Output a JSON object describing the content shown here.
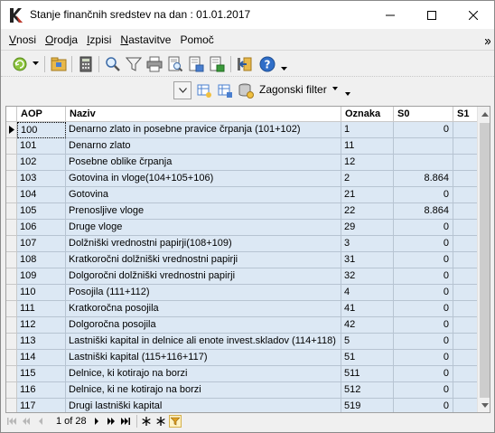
{
  "window": {
    "title": "Stanje finančnih sredstev na dan : 01.01.2017"
  },
  "menu": {
    "vnosi": {
      "accel": "V",
      "rest": "nosi"
    },
    "orodja": {
      "accel": "O",
      "rest": "rodja"
    },
    "izpisi": {
      "accel": "I",
      "rest": "zpisi"
    },
    "nastavitve": {
      "accel": "N",
      "rest": "astavitve"
    },
    "pomoc": {
      "accel": "",
      "rest": "Pomoč"
    }
  },
  "toolbar2": {
    "filter_label": "Zagonski filter"
  },
  "grid": {
    "headers": {
      "aop": "AOP",
      "naziv": "Naziv",
      "oznaka": "Oznaka",
      "s0": "S0",
      "s1": "S1"
    },
    "rows": [
      {
        "aop": "100",
        "naziv": "Denarno zlato in posebne pravice črpanja (101+102)",
        "oznaka": "1",
        "s0": "0"
      },
      {
        "aop": "101",
        "naziv": "Denarno zlato",
        "oznaka": "11",
        "s0": ""
      },
      {
        "aop": "102",
        "naziv": "Posebne oblike črpanja",
        "oznaka": "12",
        "s0": ""
      },
      {
        "aop": "103",
        "naziv": "Gotovina in vloge(104+105+106)",
        "oznaka": "2",
        "s0": "8.864"
      },
      {
        "aop": "104",
        "naziv": "Gotovina",
        "oznaka": "21",
        "s0": "0"
      },
      {
        "aop": "105",
        "naziv": "Prenosljive vloge",
        "oznaka": "22",
        "s0": "8.864"
      },
      {
        "aop": "106",
        "naziv": "Druge vloge",
        "oznaka": "29",
        "s0": "0"
      },
      {
        "aop": "107",
        "naziv": "Dolžniški vrednostni papirji(108+109)",
        "oznaka": "3",
        "s0": "0"
      },
      {
        "aop": "108",
        "naziv": "Kratkoročni dolžniški vrednostni papirji",
        "oznaka": "31",
        "s0": "0"
      },
      {
        "aop": "109",
        "naziv": "Dolgoročni dolžniški vrednostni papirji",
        "oznaka": "32",
        "s0": "0"
      },
      {
        "aop": "110",
        "naziv": "Posojila (111+112)",
        "oznaka": "4",
        "s0": "0"
      },
      {
        "aop": "111",
        "naziv": "Kratkoročna posojila",
        "oznaka": "41",
        "s0": "0"
      },
      {
        "aop": "112",
        "naziv": "Dolgoročna posojila",
        "oznaka": "42",
        "s0": "0"
      },
      {
        "aop": "113",
        "naziv": "Lastniški kapital in delnice ali enote invest.skladov (114+118)",
        "oznaka": "5",
        "s0": "0"
      },
      {
        "aop": "114",
        "naziv": "Lastniški kapital  (115+116+117)",
        "oznaka": "51",
        "s0": "0"
      },
      {
        "aop": "115",
        "naziv": "Delnice, ki kotirajo na borzi",
        "oznaka": "511",
        "s0": "0"
      },
      {
        "aop": "116",
        "naziv": "Delnice, ki ne kotirajo na borzi",
        "oznaka": "512",
        "s0": "0"
      },
      {
        "aop": "117",
        "naziv": "Drugi lastniški kapital",
        "oznaka": "519",
        "s0": "0"
      }
    ]
  },
  "navigator": {
    "page_text": "1 of 28"
  },
  "colors": {
    "row_bg": "#dce8f4",
    "accent": "#1f5fbf"
  }
}
